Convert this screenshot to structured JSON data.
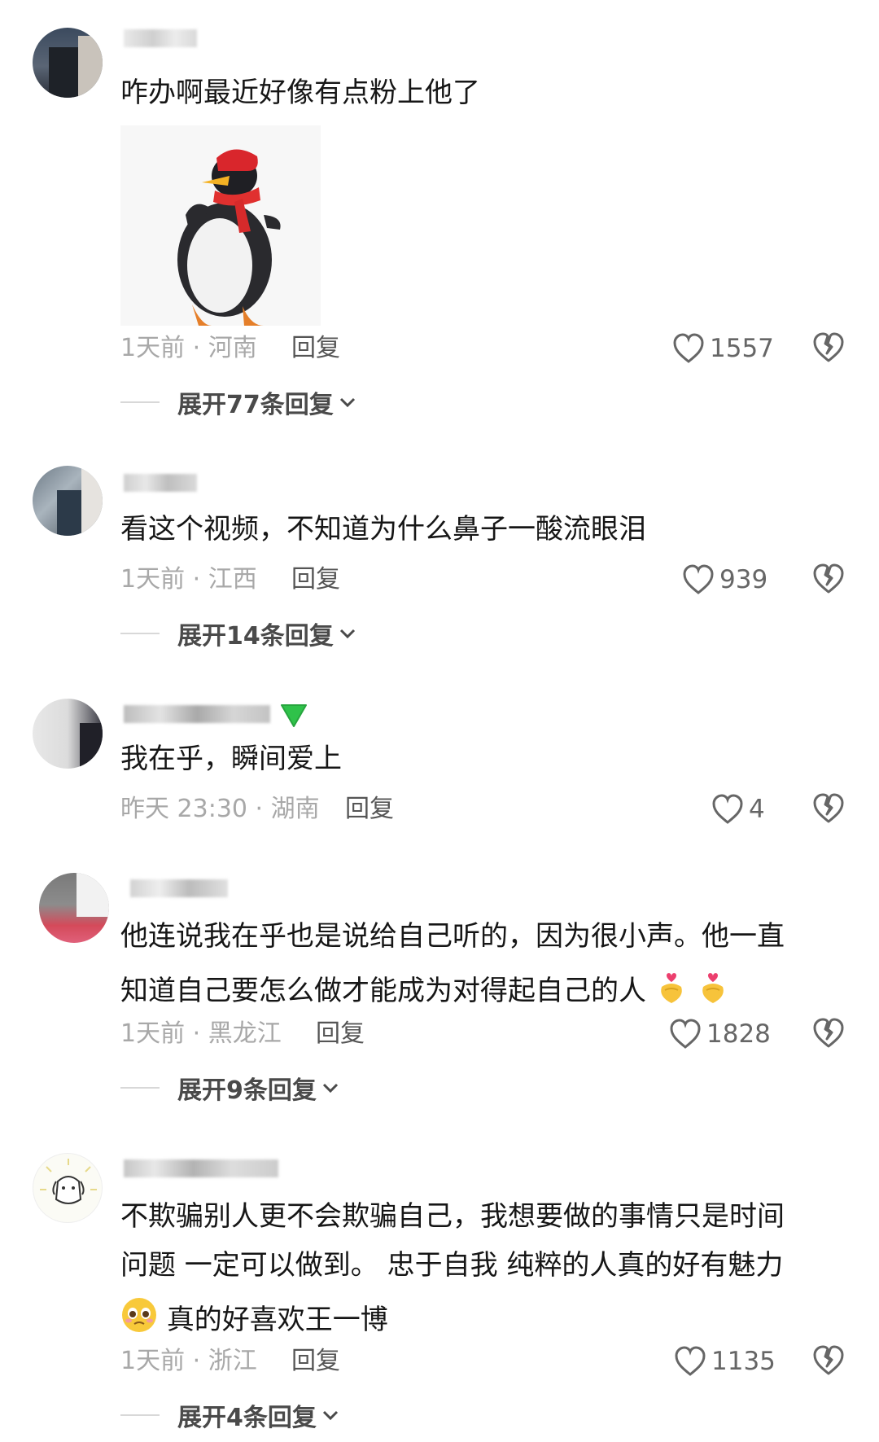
{
  "comments": [
    {
      "text": "咋办啊最近好像有点粉上他了",
      "time": "1天前 · 河南",
      "reply": "回复",
      "likes": "1557",
      "expand": "展开77条回复",
      "image": "penguin-dancing-gif"
    },
    {
      "text": "看这个视频，不知道为什么鼻子一酸流眼泪",
      "time": "1天前 · 江西",
      "reply": "回复",
      "likes": "939",
      "expand": "展开14条回复"
    },
    {
      "text": "我在乎，瞬间爱上",
      "time": "昨天 23:30 · 湖南",
      "reply": "回复",
      "likes": "4"
    },
    {
      "lines": [
        "他连说我在乎也是说给自己听的，因为很小声。他一直",
        "知道自己要怎么做才能成为对得起自己的人"
      ],
      "time": "1天前 · 黑龙江",
      "reply": "回复",
      "likes": "1828",
      "expand": "展开9条回复"
    },
    {
      "lines": [
        "不欺骗别人更不会欺骗自己，我想要做的事情只是时间",
        "问题 一定可以做到。 忠于自我 纯粹的人真的好有魅力",
        "真的好喜欢王一博"
      ],
      "time": "1天前 · 浙江",
      "reply": "回复",
      "likes": "1135",
      "expand": "展开4条回复"
    }
  ],
  "colors": {
    "text": "#161616",
    "meta": "#a8a8a8",
    "badge_green": "#2fc24a"
  },
  "icons": [
    "heart-outline-icon",
    "broken-heart-icon",
    "chevron-down-icon",
    "heart-hands-emoji-icon",
    "pleading-face-emoji-icon",
    "green-down-arrow-badge-icon"
  ]
}
